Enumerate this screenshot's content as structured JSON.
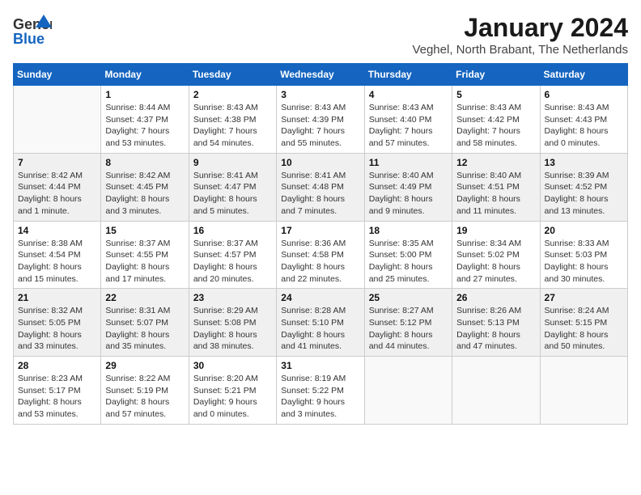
{
  "header": {
    "logo_general": "General",
    "logo_blue": "Blue",
    "title": "January 2024",
    "location": "Veghel, North Brabant, The Netherlands"
  },
  "columns": [
    "Sunday",
    "Monday",
    "Tuesday",
    "Wednesday",
    "Thursday",
    "Friday",
    "Saturday"
  ],
  "weeks": [
    {
      "shade": false,
      "days": [
        {
          "num": "",
          "info": ""
        },
        {
          "num": "1",
          "info": "Sunrise: 8:44 AM\nSunset: 4:37 PM\nDaylight: 7 hours\nand 53 minutes."
        },
        {
          "num": "2",
          "info": "Sunrise: 8:43 AM\nSunset: 4:38 PM\nDaylight: 7 hours\nand 54 minutes."
        },
        {
          "num": "3",
          "info": "Sunrise: 8:43 AM\nSunset: 4:39 PM\nDaylight: 7 hours\nand 55 minutes."
        },
        {
          "num": "4",
          "info": "Sunrise: 8:43 AM\nSunset: 4:40 PM\nDaylight: 7 hours\nand 57 minutes."
        },
        {
          "num": "5",
          "info": "Sunrise: 8:43 AM\nSunset: 4:42 PM\nDaylight: 7 hours\nand 58 minutes."
        },
        {
          "num": "6",
          "info": "Sunrise: 8:43 AM\nSunset: 4:43 PM\nDaylight: 8 hours\nand 0 minutes."
        }
      ]
    },
    {
      "shade": true,
      "days": [
        {
          "num": "7",
          "info": "Sunrise: 8:42 AM\nSunset: 4:44 PM\nDaylight: 8 hours\nand 1 minute."
        },
        {
          "num": "8",
          "info": "Sunrise: 8:42 AM\nSunset: 4:45 PM\nDaylight: 8 hours\nand 3 minutes."
        },
        {
          "num": "9",
          "info": "Sunrise: 8:41 AM\nSunset: 4:47 PM\nDaylight: 8 hours\nand 5 minutes."
        },
        {
          "num": "10",
          "info": "Sunrise: 8:41 AM\nSunset: 4:48 PM\nDaylight: 8 hours\nand 7 minutes."
        },
        {
          "num": "11",
          "info": "Sunrise: 8:40 AM\nSunset: 4:49 PM\nDaylight: 8 hours\nand 9 minutes."
        },
        {
          "num": "12",
          "info": "Sunrise: 8:40 AM\nSunset: 4:51 PM\nDaylight: 8 hours\nand 11 minutes."
        },
        {
          "num": "13",
          "info": "Sunrise: 8:39 AM\nSunset: 4:52 PM\nDaylight: 8 hours\nand 13 minutes."
        }
      ]
    },
    {
      "shade": false,
      "days": [
        {
          "num": "14",
          "info": "Sunrise: 8:38 AM\nSunset: 4:54 PM\nDaylight: 8 hours\nand 15 minutes."
        },
        {
          "num": "15",
          "info": "Sunrise: 8:37 AM\nSunset: 4:55 PM\nDaylight: 8 hours\nand 17 minutes."
        },
        {
          "num": "16",
          "info": "Sunrise: 8:37 AM\nSunset: 4:57 PM\nDaylight: 8 hours\nand 20 minutes."
        },
        {
          "num": "17",
          "info": "Sunrise: 8:36 AM\nSunset: 4:58 PM\nDaylight: 8 hours\nand 22 minutes."
        },
        {
          "num": "18",
          "info": "Sunrise: 8:35 AM\nSunset: 5:00 PM\nDaylight: 8 hours\nand 25 minutes."
        },
        {
          "num": "19",
          "info": "Sunrise: 8:34 AM\nSunset: 5:02 PM\nDaylight: 8 hours\nand 27 minutes."
        },
        {
          "num": "20",
          "info": "Sunrise: 8:33 AM\nSunset: 5:03 PM\nDaylight: 8 hours\nand 30 minutes."
        }
      ]
    },
    {
      "shade": true,
      "days": [
        {
          "num": "21",
          "info": "Sunrise: 8:32 AM\nSunset: 5:05 PM\nDaylight: 8 hours\nand 33 minutes."
        },
        {
          "num": "22",
          "info": "Sunrise: 8:31 AM\nSunset: 5:07 PM\nDaylight: 8 hours\nand 35 minutes."
        },
        {
          "num": "23",
          "info": "Sunrise: 8:29 AM\nSunset: 5:08 PM\nDaylight: 8 hours\nand 38 minutes."
        },
        {
          "num": "24",
          "info": "Sunrise: 8:28 AM\nSunset: 5:10 PM\nDaylight: 8 hours\nand 41 minutes."
        },
        {
          "num": "25",
          "info": "Sunrise: 8:27 AM\nSunset: 5:12 PM\nDaylight: 8 hours\nand 44 minutes."
        },
        {
          "num": "26",
          "info": "Sunrise: 8:26 AM\nSunset: 5:13 PM\nDaylight: 8 hours\nand 47 minutes."
        },
        {
          "num": "27",
          "info": "Sunrise: 8:24 AM\nSunset: 5:15 PM\nDaylight: 8 hours\nand 50 minutes."
        }
      ]
    },
    {
      "shade": false,
      "days": [
        {
          "num": "28",
          "info": "Sunrise: 8:23 AM\nSunset: 5:17 PM\nDaylight: 8 hours\nand 53 minutes."
        },
        {
          "num": "29",
          "info": "Sunrise: 8:22 AM\nSunset: 5:19 PM\nDaylight: 8 hours\nand 57 minutes."
        },
        {
          "num": "30",
          "info": "Sunrise: 8:20 AM\nSunset: 5:21 PM\nDaylight: 9 hours\nand 0 minutes."
        },
        {
          "num": "31",
          "info": "Sunrise: 8:19 AM\nSunset: 5:22 PM\nDaylight: 9 hours\nand 3 minutes."
        },
        {
          "num": "",
          "info": ""
        },
        {
          "num": "",
          "info": ""
        },
        {
          "num": "",
          "info": ""
        }
      ]
    }
  ]
}
